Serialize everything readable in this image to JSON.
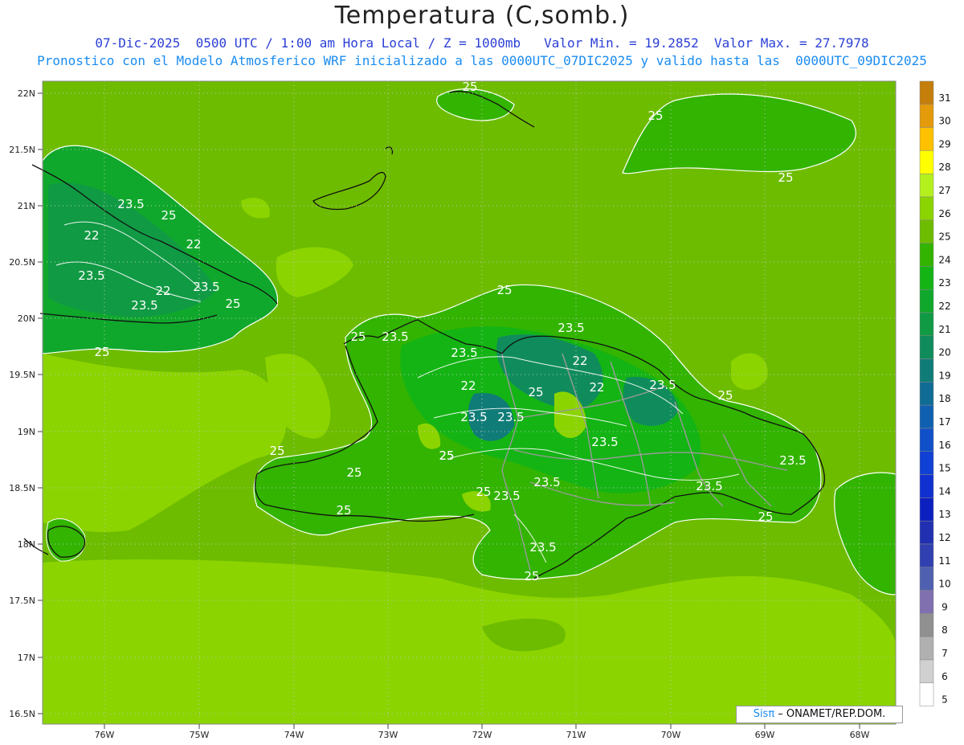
{
  "header": {
    "title": "Temperatura (C,somb.)",
    "line1": "07-Dic-2025  0500 UTC / 1:00 am Hora Local / Z = 1000mb   Valor Min. = 19.2852  Valor Max. = 27.7978",
    "line2": "Pronostico con el Modelo Atmosferico WRF inicializado a las 0000UTC_07DIC2025 y valido hasta las  0000UTC_09DIC2025"
  },
  "axes": {
    "lat_labels": [
      "22N",
      "21.5N",
      "21N",
      "20.5N",
      "20N",
      "19.5N",
      "19N",
      "18.5N",
      "18N",
      "17.5N",
      "17N",
      "16.5N"
    ],
    "lon_labels": [
      "76W",
      "75W",
      "74W",
      "73W",
      "72W",
      "71W",
      "70W",
      "69W",
      "68W"
    ]
  },
  "colorbar": {
    "levels": [
      "31",
      "30",
      "29",
      "28",
      "27",
      "26",
      "25",
      "24",
      "23",
      "22",
      "21",
      "20",
      "19",
      "18",
      "17",
      "16",
      "15",
      "14",
      "13",
      "12",
      "11",
      "10",
      "9",
      "8",
      "7",
      "6",
      "5"
    ],
    "colors": [
      "#c47e0a",
      "#e39a0b",
      "#ffc000",
      "#ffff00",
      "#b4f01e",
      "#8cd400",
      "#6ebc00",
      "#32b400",
      "#14b414",
      "#10a82c",
      "#109a44",
      "#108c5c",
      "#107c78",
      "#106c94",
      "#1060b0",
      "#1050c8",
      "#1040d4",
      "#1030d0",
      "#0c20c0",
      "#2030b0",
      "#3040b0",
      "#5060b0",
      "#8070b0",
      "#909090",
      "#b0b0b0",
      "#d0d0d0",
      "#ffffff"
    ]
  },
  "contour_labels": [
    {
      "text": "25"
    },
    {
      "text": "25"
    },
    {
      "text": "25"
    },
    {
      "text": "23.5"
    },
    {
      "text": "25"
    },
    {
      "text": "22"
    },
    {
      "text": "22"
    },
    {
      "text": "23.5"
    },
    {
      "text": "22"
    },
    {
      "text": "23.5"
    },
    {
      "text": "23.5"
    },
    {
      "text": "25"
    },
    {
      "text": "25"
    },
    {
      "text": "25"
    },
    {
      "text": "25"
    },
    {
      "text": "23.5"
    },
    {
      "text": "23.5"
    },
    {
      "text": "22"
    },
    {
      "text": "25"
    },
    {
      "text": "22"
    },
    {
      "text": "23.5"
    },
    {
      "text": "23.5"
    },
    {
      "text": "23.5"
    },
    {
      "text": "22"
    },
    {
      "text": "25"
    },
    {
      "text": "23.5"
    },
    {
      "text": "23.5"
    },
    {
      "text": "25"
    },
    {
      "text": "25"
    },
    {
      "text": "25"
    },
    {
      "text": "23.5"
    },
    {
      "text": "23.5"
    },
    {
      "text": "23.5"
    },
    {
      "text": "23.5"
    },
    {
      "text": "25"
    },
    {
      "text": "23.5"
    },
    {
      "text": "25"
    },
    {
      "text": "25"
    },
    {
      "text": "25"
    },
    {
      "text": "25"
    }
  ],
  "credit": {
    "sis": "Sisπ",
    "text": " – ONAMET/REP.DOM."
  }
}
